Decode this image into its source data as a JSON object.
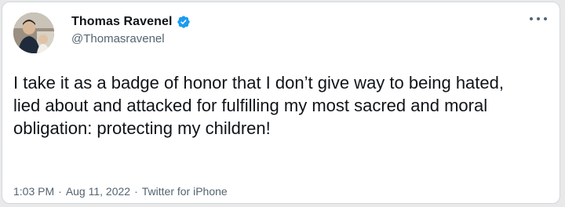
{
  "tweet": {
    "author": {
      "display_name": "Thomas Ravenel",
      "handle": "@Thomasravenel",
      "verified": true,
      "avatar_icon": "profile-photo"
    },
    "text": "I take it as a badge of honor that I don’t give way to being hated, lied about and attacked for fulfilling my most sacred and moral obligation: protecting my children!",
    "time": "1:03 PM",
    "date": "Aug 11, 2022",
    "source": "Twitter for iPhone",
    "separator": "·"
  },
  "colors": {
    "text_primary": "#0f1419",
    "text_secondary": "#536471",
    "verified_blue": "#1d9bf0",
    "card_border": "#cfd9de"
  },
  "icons": {
    "more": "more-horizontal-icon",
    "verified": "verified-badge-icon"
  }
}
